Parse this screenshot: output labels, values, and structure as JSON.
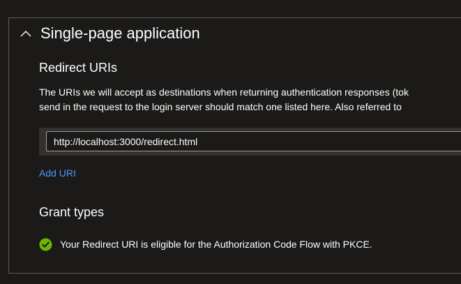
{
  "section": {
    "title": "Single-page application",
    "expanded_icon": "chevron-up-icon"
  },
  "redirect": {
    "title": "Redirect URIs",
    "description_line1": "The URIs we will accept as destinations when returning authentication responses (tok",
    "description_line2": "send in the request to the login server should match one listed here. Also referred to",
    "uri_value": "http://localhost:3000/redirect.html",
    "add_label": "Add URI"
  },
  "grant": {
    "title": "Grant types",
    "status_icon": "check-circle-icon",
    "status_color": "#6bb700",
    "eligible_text": "Your Redirect URI is eligible for the Authorization Code Flow with PKCE."
  },
  "colors": {
    "background": "#1b1a19",
    "link": "#479ef5",
    "border": "#605e5c"
  }
}
